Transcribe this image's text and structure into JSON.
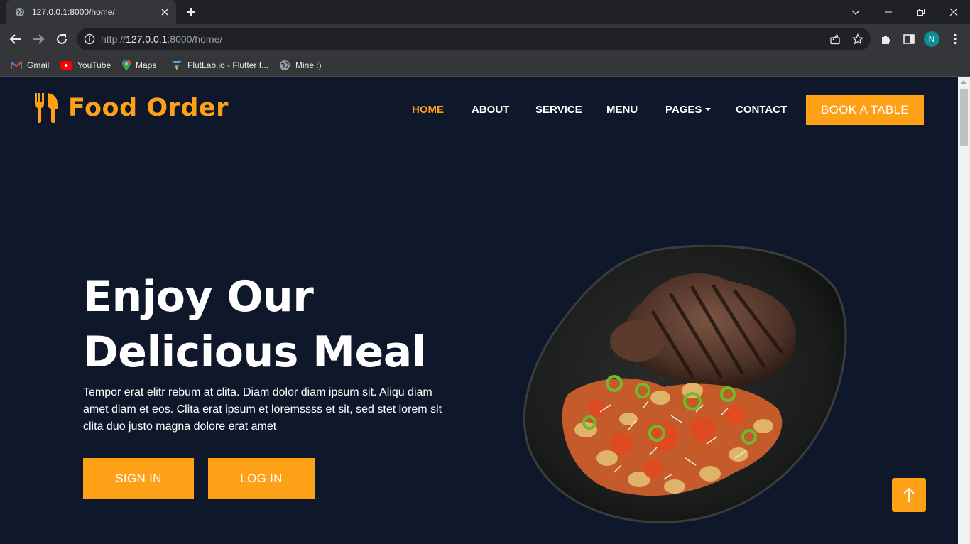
{
  "browser": {
    "tab_title": "127.0.0.1:8000/home/",
    "url_scheme": "http://",
    "url_host": "127.0.0.1",
    "url_path": ":8000/home/",
    "profile_initial": "N",
    "bookmarks": [
      {
        "label": "Gmail",
        "icon": "gmail-icon"
      },
      {
        "label": "YouTube",
        "icon": "youtube-icon"
      },
      {
        "label": "Maps",
        "icon": "maps-icon"
      },
      {
        "label": "FlutLab.io - Flutter I...",
        "icon": "flutlab-icon"
      },
      {
        "label": "Mine :)",
        "icon": "globe-icon"
      }
    ]
  },
  "site": {
    "brand": "Food Order",
    "nav": [
      {
        "label": "HOME",
        "active": true
      },
      {
        "label": "ABOUT",
        "active": false
      },
      {
        "label": "SERVICE",
        "active": false
      },
      {
        "label": "MENU",
        "active": false
      },
      {
        "label": "PAGES",
        "active": false,
        "dropdown": true
      },
      {
        "label": "CONTACT",
        "active": false
      }
    ],
    "cta": "BOOK A TABLE",
    "hero": {
      "title_line1": "Enjoy Our",
      "title_line2": "Delicious Meal",
      "text": "Tempor erat elitr rebum at clita. Diam dolor diam ipsum sit. Aliqu diam amet diam et eos. Clita erat ipsum et loremssss et sit, sed stet lorem sit clita duo justo magna dolore erat amet",
      "sign_in": "SIGN IN",
      "log_in": "LOG IN"
    }
  },
  "colors": {
    "accent": "#fea116",
    "page_bg": "#0f172b"
  }
}
